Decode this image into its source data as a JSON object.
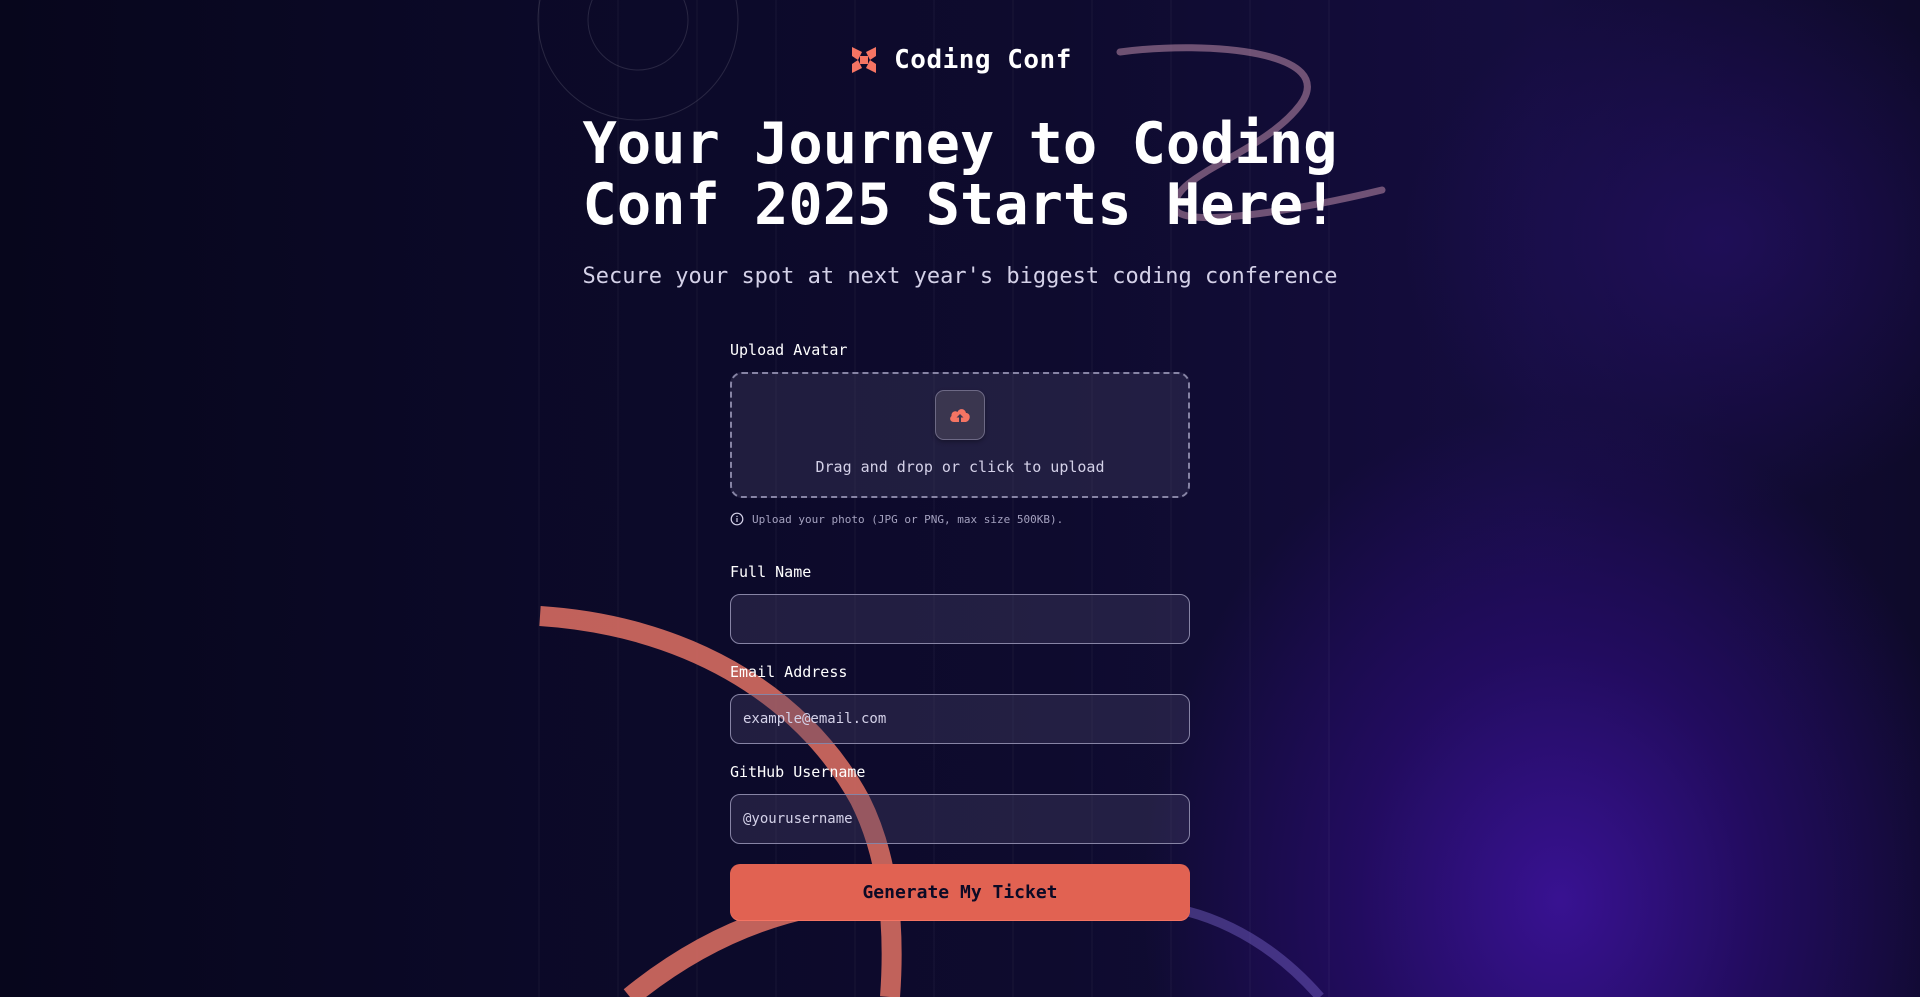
{
  "brand": {
    "name": "Coding Conf",
    "logo_icon": "coding-conf-logo-icon",
    "accent_color": "#f57463"
  },
  "hero": {
    "title": "Your Journey to Coding Conf 2025 Starts Here!",
    "subtitle": "Secure your spot at next year's biggest coding conference"
  },
  "form": {
    "avatar": {
      "label": "Upload Avatar",
      "drop_text": "Drag and drop or click to upload",
      "icon": "cloud-upload-icon",
      "hint": "Upload your photo (JPG or PNG, max size 500KB).",
      "hint_icon": "info-icon"
    },
    "full_name": {
      "label": "Full Name",
      "value": "",
      "placeholder": ""
    },
    "email": {
      "label": "Email Address",
      "value": "",
      "placeholder": "example@email.com"
    },
    "github": {
      "label": "GitHub Username",
      "value": "",
      "placeholder": "@yourusername"
    },
    "submit_label": "Generate My Ticket",
    "submit_color": "#e16252"
  }
}
